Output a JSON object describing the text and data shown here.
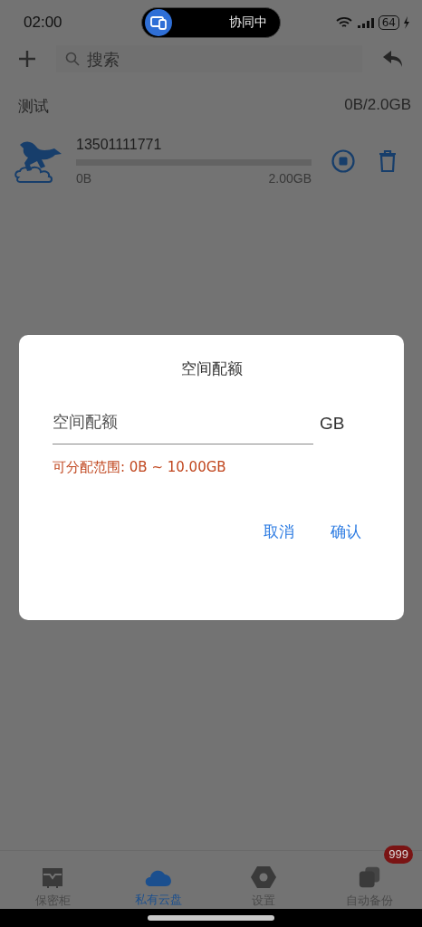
{
  "status_bar": {
    "time": "02:00",
    "pill_label": "协同中",
    "battery": "64"
  },
  "toolbar": {
    "search_placeholder": "搜索"
  },
  "group": {
    "name": "测试",
    "usage": "0B/2.0GB"
  },
  "accounts": [
    {
      "phone": "13501111771",
      "used": "0B",
      "quota": "2.00GB",
      "level": 0
    }
  ],
  "dialog": {
    "title": "空间配额",
    "field_placeholder": "空间配额",
    "unit": "GB",
    "hint": "可分配范围: 0B ~ 10.00GB",
    "buttons": [
      "取消",
      "确认"
    ]
  },
  "tabs": [
    {
      "label": "保密柜",
      "selected": false
    },
    {
      "label": "私有云盘",
      "selected": true
    },
    {
      "label": "设置",
      "selected": false
    },
    {
      "label": "自动备份",
      "selected": false,
      "badge": "999"
    }
  ]
}
